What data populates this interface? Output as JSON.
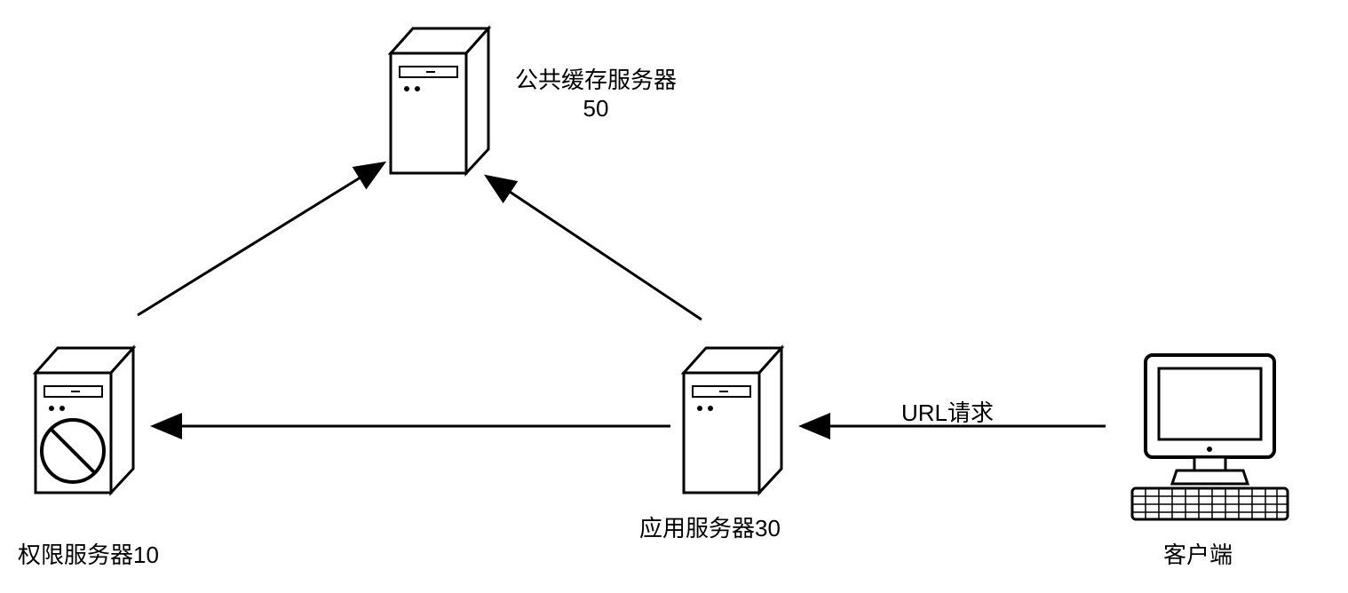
{
  "nodes": {
    "cache_server": {
      "label": "公共缓存服务器",
      "number": "50"
    },
    "permission_server": {
      "label": "权限服务器10"
    },
    "app_server": {
      "label": "应用服务器30"
    },
    "client": {
      "label": "客户端"
    }
  },
  "connections": {
    "url_request": "URL请求"
  }
}
